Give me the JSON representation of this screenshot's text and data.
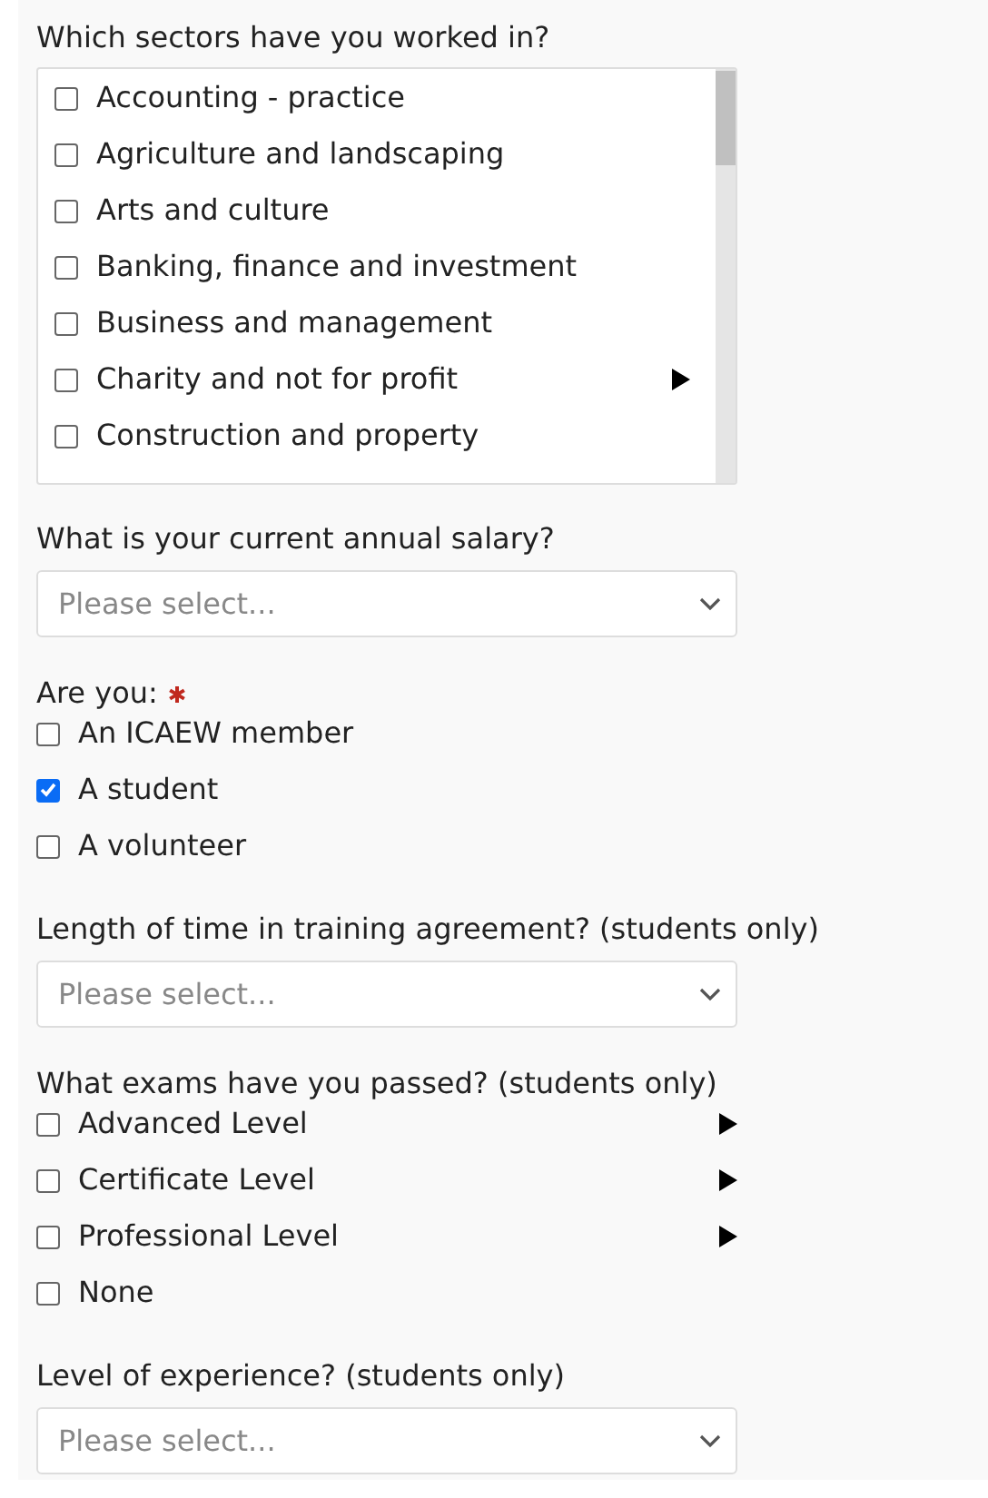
{
  "sectors": {
    "label": "Which sectors have you worked in?",
    "items": [
      {
        "label": "Accounting - practice",
        "checked": false,
        "submenu": false
      },
      {
        "label": "Agriculture and landscaping",
        "checked": false,
        "submenu": false
      },
      {
        "label": "Arts and culture",
        "checked": false,
        "submenu": false
      },
      {
        "label": "Banking, finance and investment",
        "checked": false,
        "submenu": false
      },
      {
        "label": "Business and management",
        "checked": false,
        "submenu": false
      },
      {
        "label": "Charity and not for profit",
        "checked": false,
        "submenu": true
      },
      {
        "label": "Construction and property",
        "checked": false,
        "submenu": false
      }
    ]
  },
  "salary": {
    "label": "What is your current annual salary?",
    "placeholder": "Please select..."
  },
  "are_you": {
    "label": "Are you:",
    "required": true,
    "options": [
      {
        "label": "An ICAEW member",
        "checked": false
      },
      {
        "label": "A student",
        "checked": true
      },
      {
        "label": "A volunteer",
        "checked": false
      }
    ]
  },
  "training_length": {
    "label": "Length of time in training agreement? (students only)",
    "placeholder": "Please select..."
  },
  "exams": {
    "label": "What exams have you passed? (students only)",
    "options": [
      {
        "label": "Advanced Level",
        "checked": false,
        "submenu": true
      },
      {
        "label": "Certificate Level",
        "checked": false,
        "submenu": true
      },
      {
        "label": "Professional Level",
        "checked": false,
        "submenu": true
      },
      {
        "label": "None",
        "checked": false,
        "submenu": false
      }
    ]
  },
  "experience": {
    "label": "Level of experience? (students only)",
    "placeholder": "Please select..."
  }
}
